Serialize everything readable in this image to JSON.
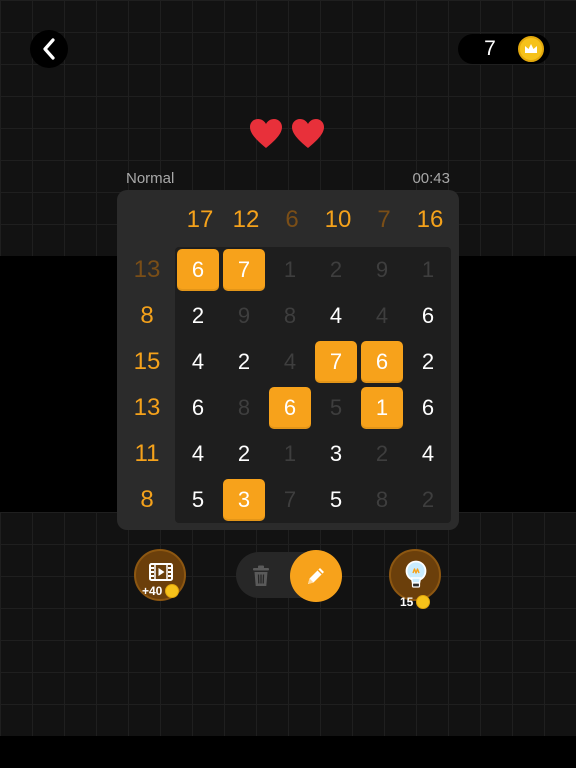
{
  "header": {
    "back_icon": "chevron-left-icon",
    "coins": "7",
    "coin_icon": "crown-coin-icon"
  },
  "lives": {
    "count": 2,
    "icon": "heart-icon",
    "color": "#e8303a"
  },
  "game": {
    "difficulty": "Normal",
    "timer": "00:43",
    "column_sums": [
      {
        "value": "17",
        "state": "active"
      },
      {
        "value": "12",
        "state": "active"
      },
      {
        "value": "6",
        "state": "done"
      },
      {
        "value": "10",
        "state": "active"
      },
      {
        "value": "7",
        "state": "done"
      },
      {
        "value": "16",
        "state": "active"
      }
    ],
    "row_sums": [
      {
        "value": "13",
        "state": "done"
      },
      {
        "value": "8",
        "state": "active"
      },
      {
        "value": "15",
        "state": "active"
      },
      {
        "value": "13",
        "state": "active"
      },
      {
        "value": "11",
        "state": "active"
      },
      {
        "value": "8",
        "state": "active"
      }
    ],
    "grid": [
      [
        {
          "v": "6",
          "s": "kept"
        },
        {
          "v": "7",
          "s": "kept"
        },
        {
          "v": "1",
          "s": "dim"
        },
        {
          "v": "2",
          "s": "dim"
        },
        {
          "v": "9",
          "s": "dim"
        },
        {
          "v": "1",
          "s": "dim"
        }
      ],
      [
        {
          "v": "2",
          "s": "normal"
        },
        {
          "v": "9",
          "s": "dim"
        },
        {
          "v": "8",
          "s": "dim"
        },
        {
          "v": "4",
          "s": "normal"
        },
        {
          "v": "4",
          "s": "dim"
        },
        {
          "v": "6",
          "s": "normal"
        }
      ],
      [
        {
          "v": "4",
          "s": "normal"
        },
        {
          "v": "2",
          "s": "normal"
        },
        {
          "v": "4",
          "s": "dim"
        },
        {
          "v": "7",
          "s": "kept"
        },
        {
          "v": "6",
          "s": "kept"
        },
        {
          "v": "2",
          "s": "normal"
        }
      ],
      [
        {
          "v": "6",
          "s": "normal"
        },
        {
          "v": "8",
          "s": "dim"
        },
        {
          "v": "6",
          "s": "kept"
        },
        {
          "v": "5",
          "s": "dim"
        },
        {
          "v": "1",
          "s": "kept"
        },
        {
          "v": "6",
          "s": "normal"
        }
      ],
      [
        {
          "v": "4",
          "s": "normal"
        },
        {
          "v": "2",
          "s": "normal"
        },
        {
          "v": "1",
          "s": "dim"
        },
        {
          "v": "3",
          "s": "normal"
        },
        {
          "v": "2",
          "s": "dim"
        },
        {
          "v": "4",
          "s": "normal"
        }
      ],
      [
        {
          "v": "5",
          "s": "normal"
        },
        {
          "v": "3",
          "s": "kept"
        },
        {
          "v": "7",
          "s": "dim"
        },
        {
          "v": "5",
          "s": "normal"
        },
        {
          "v": "8",
          "s": "dim"
        },
        {
          "v": "2",
          "s": "dim"
        }
      ]
    ]
  },
  "tools": {
    "video_reward": "+40",
    "video_icon": "film-play-icon",
    "trash_icon": "trash-icon",
    "pencil_icon": "pencil-icon",
    "hint_icon": "lightbulb-icon",
    "hint_cost": "15"
  },
  "colors": {
    "accent": "#f7a21b",
    "sum_done": "#7a4e17",
    "dim_number": "#3e3e3e",
    "board": "#2b2b2b"
  }
}
